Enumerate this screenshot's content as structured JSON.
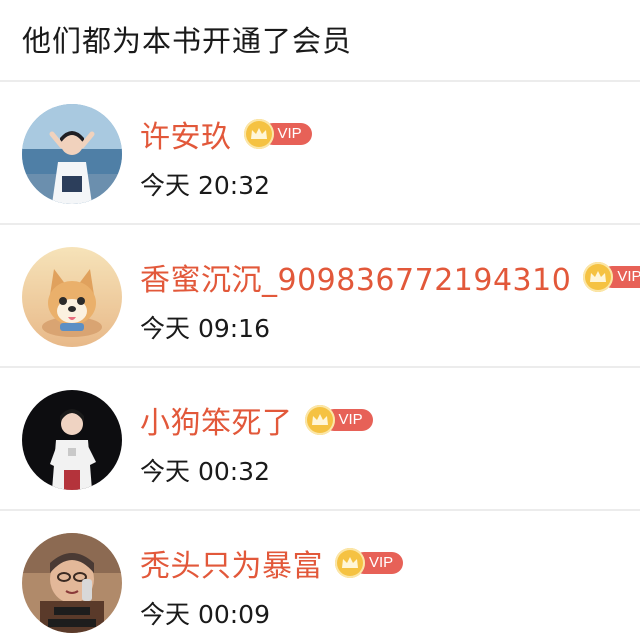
{
  "header": {
    "title": "他们都为本书开通了会员"
  },
  "members": [
    {
      "name": "许安玖",
      "badge": "VIP",
      "time": "今天 20:32",
      "avatar_icon": "girl-seaside-photo"
    },
    {
      "name": "香蜜沉沉_909836772194310",
      "badge": "VIP",
      "time": "今天 09:16",
      "avatar_icon": "shiba-dog-illustration"
    },
    {
      "name": "小狗笨死了",
      "badge": "VIP",
      "time": "今天 00:32",
      "avatar_icon": "idol-photo"
    },
    {
      "name": "秃头只为暴富",
      "badge": "VIP",
      "time": "今天 00:09",
      "avatar_icon": "grandma-phone-meme"
    }
  ],
  "colors": {
    "name": "#e2583a",
    "vip_pill": "#e76157",
    "crown": "#f5c242",
    "divider": "#ececec"
  }
}
